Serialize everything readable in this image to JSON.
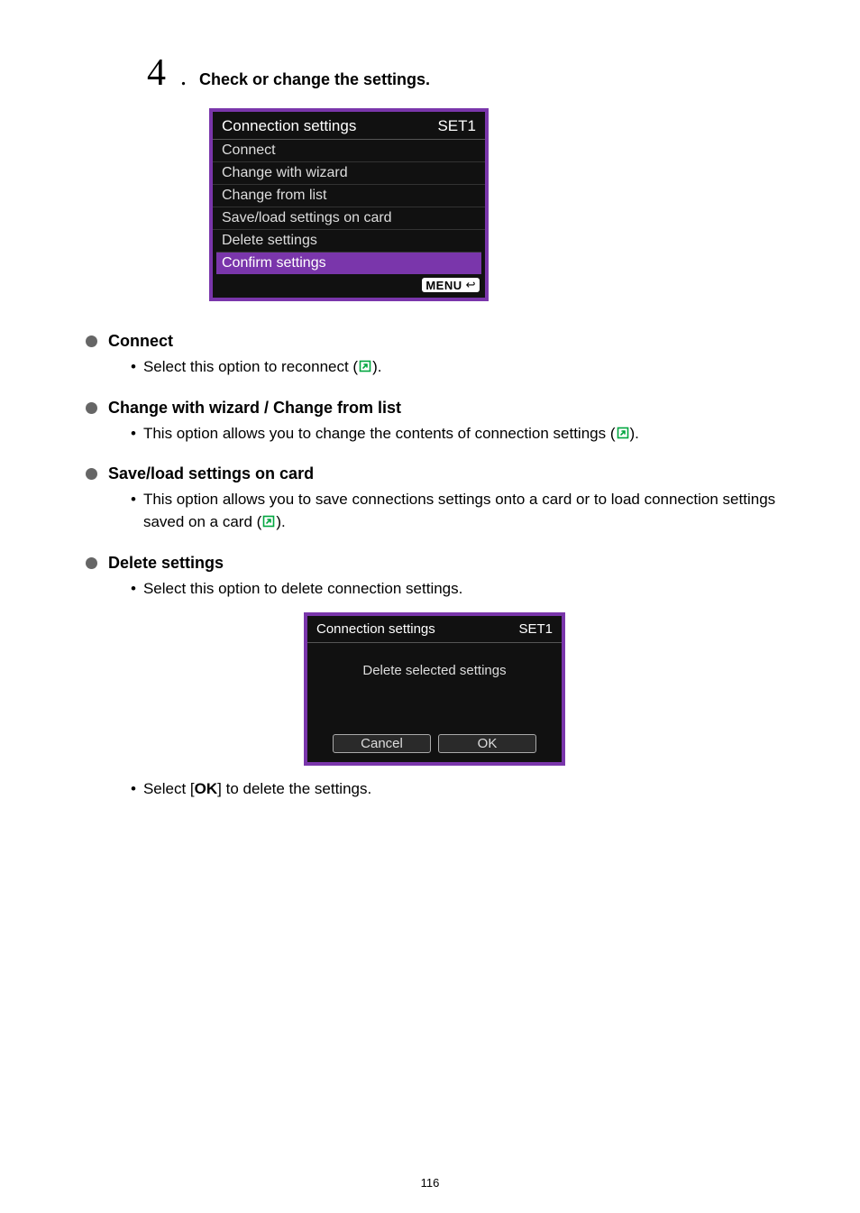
{
  "step": {
    "number": "4",
    "dot": ".",
    "title": "Check or change the settings."
  },
  "screen1": {
    "title": "Connection settings",
    "set": "SET1",
    "rows": {
      "connect": "Connect",
      "change_wizard": "Change with wizard",
      "change_list": "Change from list",
      "save_load": "Save/load settings on card",
      "delete": "Delete settings",
      "confirm": "Confirm settings"
    },
    "menu_label": "MENU",
    "menu_back": "↩"
  },
  "sections": {
    "connect": {
      "title": "Connect",
      "items": {
        "reconnect_pre": "Select this option to reconnect (",
        "reconnect_post": ")."
      }
    },
    "change": {
      "title": "Change with wizard / Change from list",
      "items": {
        "text_pre": "This option allows you to change the contents of connection settings (",
        "text_post": ")."
      }
    },
    "saveload": {
      "title": "Save/load settings on card",
      "items": {
        "text_pre": "This option allows you to save connections settings onto a card or to load connection settings saved on a card (",
        "text_post": ")."
      }
    },
    "delete": {
      "title": "Delete settings",
      "items": {
        "text": "Select this option to delete connection settings.",
        "after_pre": "Select [",
        "after_bold": "OK",
        "after_post": "] to delete the settings."
      }
    }
  },
  "screen2": {
    "title": "Connection settings",
    "set": "SET1",
    "body": "Delete selected settings",
    "cancel": "Cancel",
    "ok": "OK"
  },
  "page_number": "116"
}
